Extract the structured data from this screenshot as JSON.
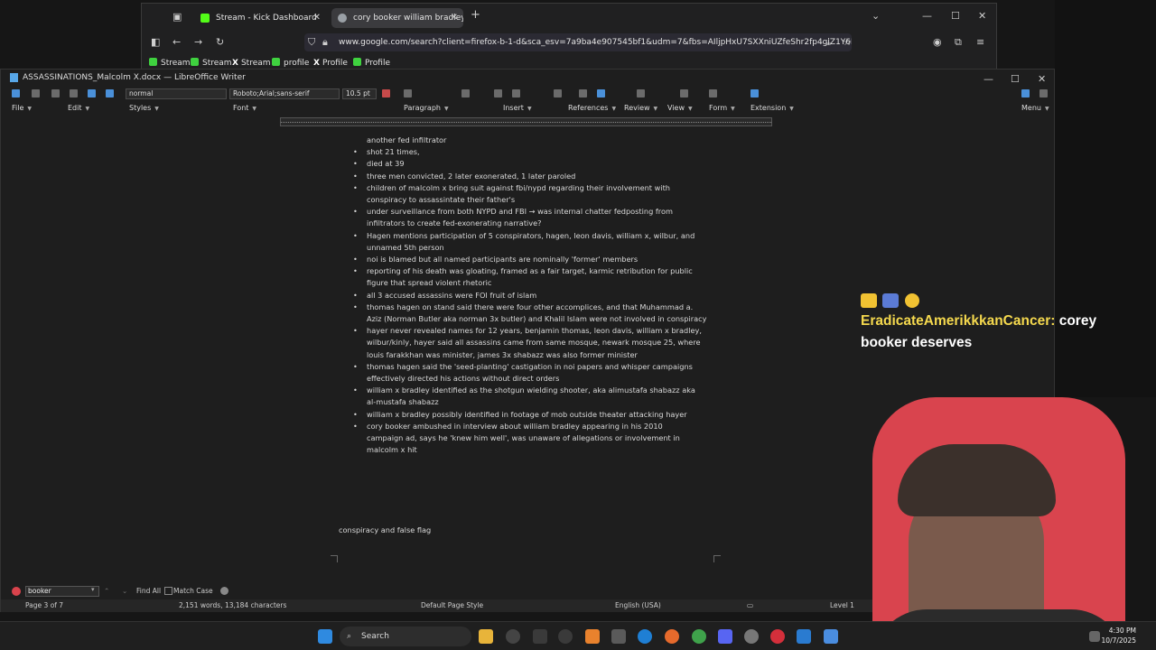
{
  "firefox": {
    "tabs": [
      {
        "title": "Stream - Kick Dashboard",
        "favicon_color": "#53fc18",
        "active": false
      },
      {
        "title": "cory booker william bradley - G",
        "favicon_color": "#9aa0a6",
        "active": true
      }
    ],
    "new_tab": "+",
    "url": "www.google.com/search?client=firefox-b-1-d&sca_esv=7a9ba4e907545bf1&udm=7&fbs=AIljpHxU7SXXniUZfeShr2fp4giZ1Y6NJ25",
    "bookmarks": [
      {
        "label": "Stream",
        "type": "kick"
      },
      {
        "label": "Stream",
        "type": "kick"
      },
      {
        "label": "Stream",
        "type": "x"
      },
      {
        "label": "profile",
        "type": "kick"
      },
      {
        "label": "Profile",
        "type": "x"
      },
      {
        "label": "Profile",
        "type": "kick"
      }
    ]
  },
  "writer": {
    "title": "ASSASSINATIONS_Malcolm X.docx — LibreOffice Writer",
    "toolbar": {
      "style": "normal",
      "font": "Roboto;Arial;sans-serif",
      "size": "10.5 pt"
    },
    "menu": [
      "File",
      "Edit",
      "Styles",
      "Font",
      "Paragraph",
      "Insert",
      "References",
      "Review",
      "View",
      "Form",
      "Extension",
      "Menu"
    ],
    "doc_lines": [
      {
        "text": "another fed infiltrator",
        "bullet": false
      },
      {
        "text": "shot 21 times,",
        "bullet": true
      },
      {
        "text": "died at 39",
        "bullet": true
      },
      {
        "text": "three men convicted, 2 later exonerated, 1 later paroled",
        "bullet": true
      },
      {
        "text": "children of malcolm x bring suit against fbi/nypd regarding their involvement with",
        "bullet": true
      },
      {
        "text": "conspiracy to assassintate their father's",
        "bullet": false
      },
      {
        "text": "under surveillance from both NYPD and FBI → was internal chatter fedposting from",
        "bullet": true
      },
      {
        "text": "infiltrators to create fed-exonerating narrative?",
        "bullet": false
      },
      {
        "text": "Hagen mentions participation of 5 conspirators, hagen, leon davis, william x, wilbur, and",
        "bullet": true
      },
      {
        "text": "unnamed 5th person",
        "bullet": false
      },
      {
        "text": "noi is blamed but all named participants are nominally 'former' members",
        "bullet": true
      },
      {
        "text": "reporting of his death was gloating, framed as a fair target, karmic retribution for public",
        "bullet": true
      },
      {
        "text": "figure that spread violent rhetoric",
        "bullet": false
      },
      {
        "text": "all 3 accused assassins were FOI fruit of islam",
        "bullet": true
      },
      {
        "text": "thomas hagen on stand said there were four other accomplices, and that Muhammad a.",
        "bullet": true
      },
      {
        "text": "Aziz (Norman Butler aka norman 3x butler) and Khalil Islam were not involved in conspiracy",
        "bullet": false
      },
      {
        "text": "hayer never revealed names for 12 years, benjamin thomas, leon davis, william x bradley,",
        "bullet": true
      },
      {
        "text": "wilbur/kinly, hayer said all assassins came from same mosque, newark mosque 25, where",
        "bullet": false
      },
      {
        "text": "louis farakkhan was minister, james 3x shabazz was also former minister",
        "bullet": false
      },
      {
        "text": "thomas hagen said the 'seed-planting' castigation in noi papers and whisper campaigns",
        "bullet": true
      },
      {
        "text": "effectively directed his actions without direct orders",
        "bullet": false
      },
      {
        "text": "william x bradley identified as the shotgun wielding shooter, aka alimustafa shabazz aka",
        "bullet": true
      },
      {
        "text": "al-mustafa shabazz",
        "bullet": false
      },
      {
        "text": "william x bradley possibly identified in footage of mob outside theater attacking hayer",
        "bullet": true
      },
      {
        "text": "cory booker ambushed in interview about william bradley appearing in his 2010",
        "bullet": true
      },
      {
        "text": "campaign ad, says he 'knew him well', was unaware of allegations or involvement in",
        "bullet": false
      },
      {
        "text": "malcolm x hit",
        "bullet": false
      }
    ],
    "paragraph": "conspiracy and false flag",
    "find": {
      "query": "booker",
      "find_all": "Find All",
      "match_case": "Match Case"
    },
    "status": {
      "page": "Page 3 of 7",
      "words": "2,151 words, 13,184 characters",
      "page_style": "Default Page Style",
      "language": "English (USA)",
      "level": "Level 1"
    }
  },
  "chat": {
    "user": "EradicateAmerikkkanCancer:",
    "message": "corey booker deserves"
  },
  "taskbar": {
    "search": "Search",
    "time": "4:30 PM",
    "date": "10/7/2025"
  }
}
